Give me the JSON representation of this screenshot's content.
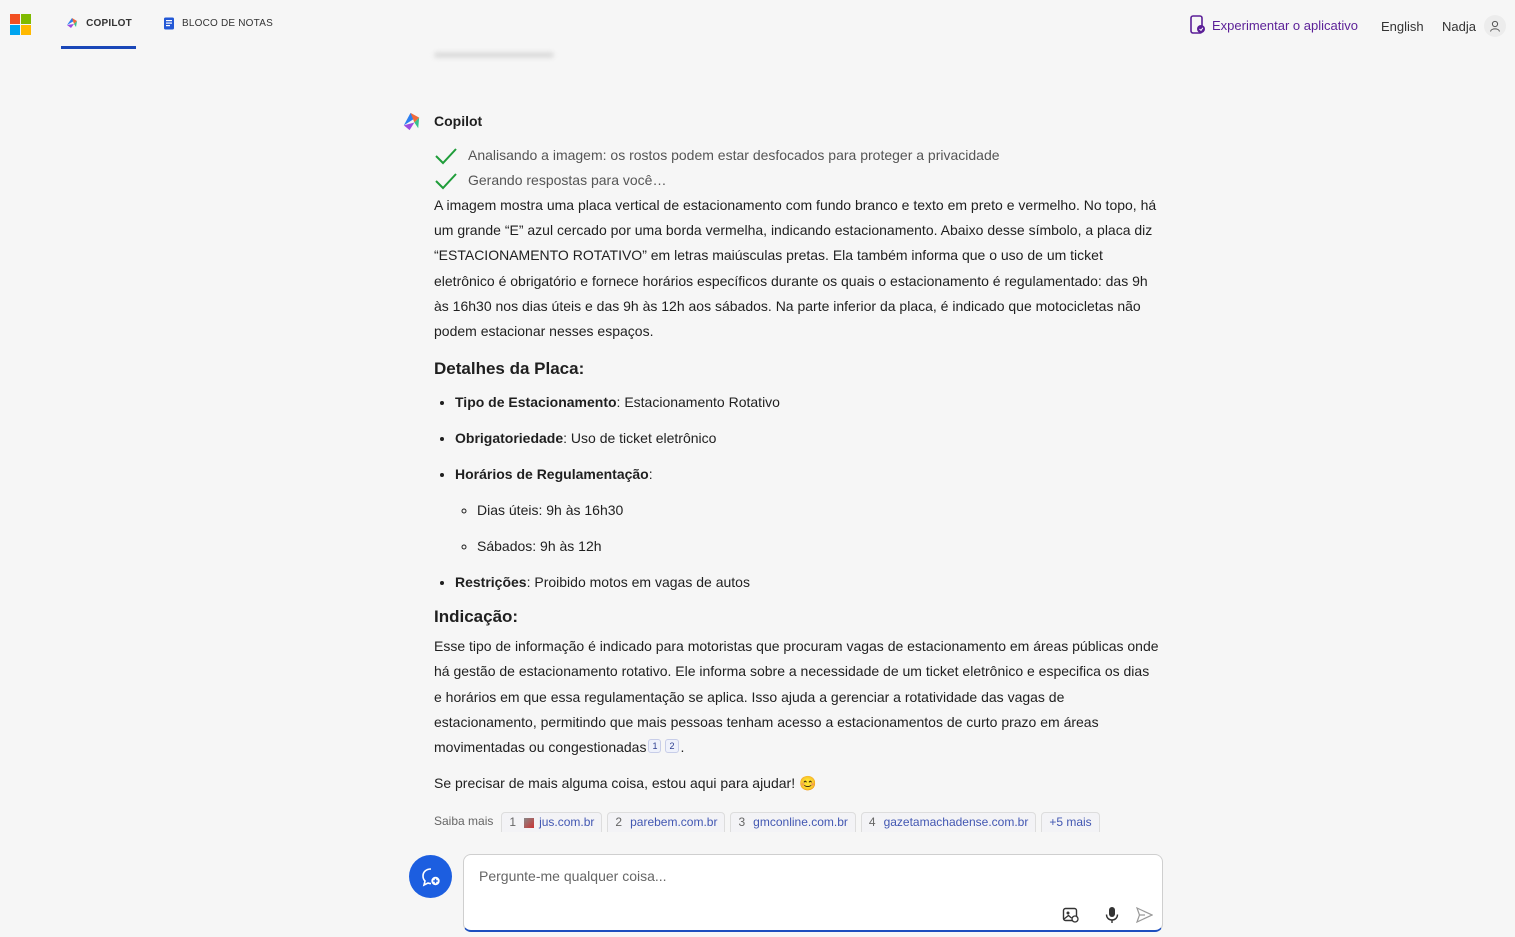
{
  "topbar": {
    "tabs": [
      {
        "label": "COPILOT",
        "icon": "copilot-icon"
      },
      {
        "label": "BLOCO DE NOTAS",
        "icon": "notebook-icon"
      }
    ],
    "try_app": "Experimentar o aplicativo",
    "language": "English",
    "user": "Nadja"
  },
  "message": {
    "author": "Copilot",
    "steps": [
      "Analisando a imagem: os rostos podem estar desfocados para proteger a privacidade",
      "Gerando respostas para você…"
    ],
    "intro": "A imagem mostra uma placa vertical de estacionamento com fundo branco e texto em preto e vermelho. No topo, há um grande “E” azul cercado por uma borda vermelha, indicando estacionamento. Abaixo desse símbolo, a placa diz “ESTACIONAMENTO ROTATIVO” em letras maiúsculas pretas. Ela também informa que o uso de um ticket eletrônico é obrigatório e fornece horários específicos durante os quais o estacionamento é regulamentado: das 9h às 16h30 nos dias úteis e das 9h às 12h aos sábados. Na parte inferior da placa, é indicado que motocicletas não podem estacionar nesses espaços.",
    "details_heading": "Detalhes da Placa:",
    "details": [
      {
        "label": "Tipo de Estacionamento",
        "value": ": Estacionamento Rotativo"
      },
      {
        "label": "Obrigatoriedade",
        "value": ": Uso de ticket eletrônico"
      },
      {
        "label": "Horários de Regulamentação",
        "value": ":"
      },
      {
        "label": "Restrições",
        "value": ": Proibido motos em vagas de autos"
      }
    ],
    "schedule": [
      "Dias úteis: 9h às 16h30",
      "Sábados: 9h às 12h"
    ],
    "indication_heading": "Indicação:",
    "indication": "Esse tipo de informação é indicado para motoristas que procuram vagas de estacionamento em áreas públicas onde há gestão de estacionamento rotativo. Ele informa sobre a necessidade de um ticket eletrônico e especifica os dias e horários em que essa regulamentação se aplica. Isso ajuda a gerenciar a rotatividade das vagas de estacionamento, permitindo que mais pessoas tenham acesso a estacionamentos de curto prazo em áreas movimentadas ou congestionadas",
    "citations": [
      "1",
      "2"
    ],
    "closing": "Se precisar de mais alguma coisa, estou aqui para ajudar! 😊",
    "learn_more": "Saiba mais",
    "sources": [
      {
        "n": "1",
        "domain": "jus.com.br"
      },
      {
        "n": "2",
        "domain": "parebem.com.br"
      },
      {
        "n": "3",
        "domain": "gmconline.com.br"
      },
      {
        "n": "4",
        "domain": "gazetamachadense.com.br"
      }
    ],
    "more_sources": "+5 mais"
  },
  "composer": {
    "placeholder": "Pergunte-me qualquer coisa..."
  },
  "colors": {
    "accent": "#1c5ee0",
    "purple": "#5b1f97",
    "check": "#1f9d3a"
  }
}
